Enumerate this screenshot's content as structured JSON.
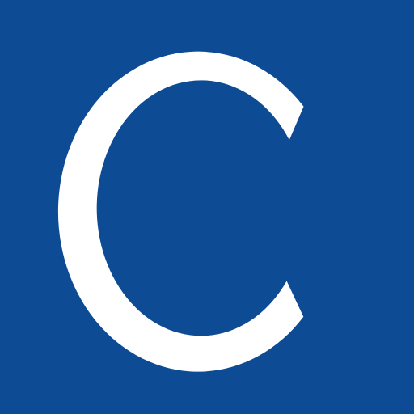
{
  "logo": {
    "letter": "C",
    "background_color": "#0d4c94",
    "letter_color": "#ffffff",
    "icon": "letter-c-logo"
  }
}
